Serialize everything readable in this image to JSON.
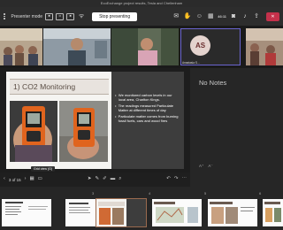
{
  "window": {
    "title": "EcoExchange project results, Tesla and Chellenham"
  },
  "toolbar": {
    "presenter_mode_label": "Presenter mode",
    "stop_presenting_label": "Stop presenting",
    "timer": "46:11",
    "leave_label": "✕"
  },
  "participants": [
    {
      "kind": "video",
      "name": ""
    },
    {
      "kind": "video",
      "name": ""
    },
    {
      "kind": "video",
      "name": ""
    },
    {
      "kind": "avatar",
      "initials": "AS",
      "name": "Anastasia S..."
    },
    {
      "kind": "video",
      "name": ""
    }
  ],
  "slide": {
    "title": "1) CO2 Monitoring",
    "bullets": [
      "We monitored carbon levels in our local area, Charlton Kings.",
      "The readings measured Particulate Matter at different times of day",
      "Particulate matter comes from burning fossil fuels, cars and wood fires"
    ],
    "caption": "Grid view (G)"
  },
  "notes": {
    "placeholder": "No Notes",
    "zoom_in": "A⁺",
    "zoom_out": "A⁻"
  },
  "navigation": {
    "page_counter": "3 of 15"
  },
  "thumbnails": [
    {
      "number": "",
      "selected": false
    },
    {
      "number": "",
      "selected": false
    },
    {
      "number": "3",
      "selected": true
    },
    {
      "number": "4",
      "selected": false
    },
    {
      "number": "5",
      "selected": false
    },
    {
      "number": "6",
      "selected": false
    }
  ],
  "colors": {
    "accent": "#6b66d1",
    "leave": "#c4314b",
    "slide_dark": "#3d3d3d",
    "title_text": "#5a4d44"
  }
}
